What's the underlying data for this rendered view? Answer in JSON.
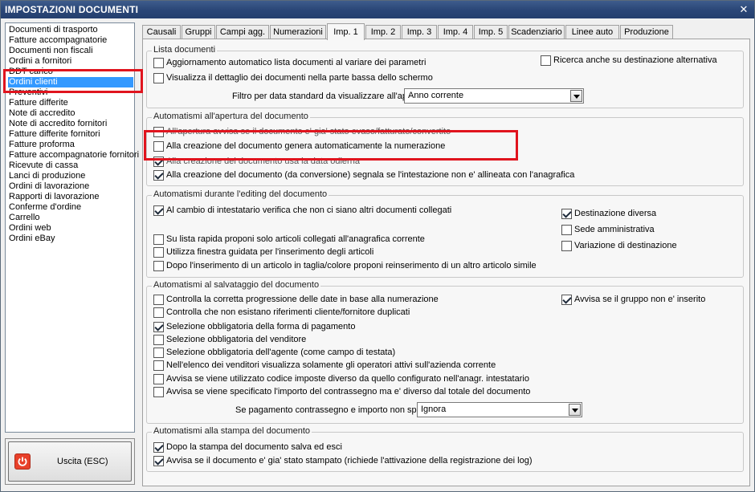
{
  "window": {
    "title": "IMPOSTAZIONI DOCUMENTI",
    "close_glyph": "✕"
  },
  "colors": {
    "titlebar": "#2b4778",
    "selection": "#3399ff",
    "highlight_box": "#e0141e",
    "exit_icon": "#e8402a"
  },
  "sidebar": {
    "items": [
      {
        "label": "Documenti di trasporto",
        "selected": false
      },
      {
        "label": "Fatture accompagnatorie",
        "selected": false
      },
      {
        "label": "Documenti non fiscali",
        "selected": false
      },
      {
        "label": "Ordini a fornitori",
        "selected": false
      },
      {
        "label": "DDT carico",
        "selected": false
      },
      {
        "label": "Ordini clienti",
        "selected": true
      },
      {
        "label": "Preventivi",
        "selected": false
      },
      {
        "label": "Fatture differite",
        "selected": false
      },
      {
        "label": "Note di accredito",
        "selected": false
      },
      {
        "label": "Note di accredito fornitori",
        "selected": false
      },
      {
        "label": "Fatture differite fornitori",
        "selected": false
      },
      {
        "label": "Fatture proforma",
        "selected": false
      },
      {
        "label": "Fatture accompagnatorie fornitori",
        "selected": false
      },
      {
        "label": "Ricevute di cassa",
        "selected": false
      },
      {
        "label": "Lanci di produzione",
        "selected": false
      },
      {
        "label": "Ordini di lavorazione",
        "selected": false
      },
      {
        "label": "Rapporti di lavorazione",
        "selected": false
      },
      {
        "label": "Conferme d'ordine",
        "selected": false
      },
      {
        "label": "Carrello",
        "selected": false
      },
      {
        "label": "Ordini web",
        "selected": false
      },
      {
        "label": "Ordini eBay",
        "selected": false
      }
    ],
    "exit_button": {
      "label": "Uscita (ESC)",
      "icon": "power-icon"
    }
  },
  "tabs": [
    {
      "label": "Causali",
      "active": false
    },
    {
      "label": "Gruppi",
      "active": false
    },
    {
      "label": "Campi agg.",
      "active": false
    },
    {
      "label": "Numerazioni",
      "active": false
    },
    {
      "label": "Imp. 1",
      "active": true
    },
    {
      "label": "Imp. 2",
      "active": false
    },
    {
      "label": "Imp. 3",
      "active": false
    },
    {
      "label": "Imp. 4",
      "active": false
    },
    {
      "label": "Imp. 5",
      "active": false
    },
    {
      "label": "Scadenziario",
      "active": false
    },
    {
      "label": "Linee auto",
      "active": false
    },
    {
      "label": "Produzione",
      "active": false
    }
  ],
  "lista_documenti": {
    "title": "Lista documenti",
    "checkboxes": [
      {
        "label": "Aggiornamento automatico lista documenti al variare dei parametri",
        "checked": false
      },
      {
        "label": "Visualizza il dettaglio dei documenti nella parte bassa dello schermo",
        "checked": false
      },
      {
        "label": "Ricerca anche su destinazione alternativa",
        "checked": false
      }
    ],
    "filter_label": "Filtro per data standard da visualizzare all'apertura :",
    "filter_value": "Anno corrente"
  },
  "apertura": {
    "title": "Automatismi all'apertura del documento",
    "checkboxes": [
      {
        "label": "All'apertura avvisa se il documento e' gia' stato evaso/fatturato/convertito",
        "checked": false
      },
      {
        "label": "Alla creazione del documento genera automaticamente la numerazione",
        "checked": false
      },
      {
        "label": "Alla creazione del documento usa la data odierna",
        "checked": true
      },
      {
        "label": "Alla creazione del documento (da conversione) segnala se l'intestazione non e' allineata con l'anagrafica",
        "checked": true
      }
    ]
  },
  "editing": {
    "title": "Automatismi durante l'editing del documento",
    "checkboxes": [
      {
        "label": "Al cambio di intestatario verifica che non ci siano altri documenti collegati",
        "checked": true
      },
      {
        "label": "Su lista rapida proponi solo articoli collegati all'anagrafica corrente",
        "checked": false
      },
      {
        "label": "Utilizza finestra guidata per l'inserimento degli articoli",
        "checked": false
      },
      {
        "label": "Dopo l'inserimento di un articolo in taglia/colore proponi reinserimento di un altro articolo simile",
        "checked": false
      },
      {
        "label": "Destinazione diversa",
        "checked": true
      },
      {
        "label": "Sede amministrativa",
        "checked": false
      },
      {
        "label": "Variazione di destinazione",
        "checked": false
      }
    ]
  },
  "salvataggio": {
    "title": "Automatismi al salvataggio del documento",
    "checkboxes": [
      {
        "label": "Controlla la corretta progressione delle date in base alla numerazione",
        "checked": false
      },
      {
        "label": "Controlla che non esistano riferimenti cliente/fornitore duplicati",
        "checked": false
      },
      {
        "label": "Selezione obbligatoria della forma di pagamento",
        "checked": true
      },
      {
        "label": "Selezione obbligatoria del venditore",
        "checked": false
      },
      {
        "label": "Selezione obbligatoria dell'agente (come campo di testata)",
        "checked": false
      },
      {
        "label": "Nell'elenco dei venditori visualizza solamente gli operatori attivi sull'azienda corrente",
        "checked": false
      },
      {
        "label": "Avvisa se viene utilizzato codice imposte diverso da quello configurato nell'anagr. intestatario",
        "checked": false
      },
      {
        "label": "Avvisa se viene specificato l'importo del contrassegno ma e' diverso dal totale del documento",
        "checked": false
      },
      {
        "label": "Avvisa se il gruppo non e' inserito",
        "checked": true
      }
    ],
    "payment_label": "Se pagamento contrassegno e importo non specificato :",
    "payment_value": "Ignora"
  },
  "stampa": {
    "title": "Automatismi alla stampa del documento",
    "checkboxes": [
      {
        "label": "Dopo la stampa del documento salva ed esci",
        "checked": true
      },
      {
        "label": "Avvisa se il documento e' gia' stato stampato (richiede l'attivazione della registrazione dei log)",
        "checked": true
      }
    ]
  }
}
